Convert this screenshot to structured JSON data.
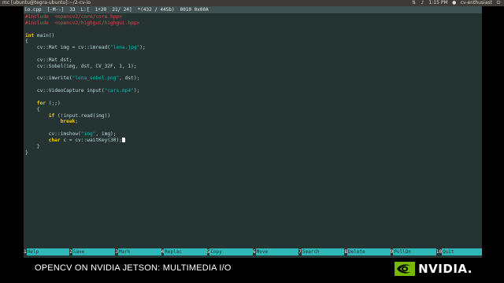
{
  "window": {
    "title": "mc [ubuntu@tegra-ubuntu]:~/2-cv-io",
    "tray_time": "1:15 PM",
    "tray_user": "cv-enthusiast"
  },
  "statusline": {
    "file": "io.cpp",
    "mode": "[-M--]",
    "col": "33",
    "lines": "L:[  1+20  21/ 24]",
    "char": "*(432 / 445b)",
    "code": "0010 0x00A"
  },
  "code": {
    "include1": "#include  <opencv2/core/core.hpp>",
    "include2": "#include  <opencv2/highgui/highgui.hpp>",
    "main_kw": "int",
    "main_sig": " main()",
    "open_brace": "{",
    "mat_img_pre": "    cv::Mat img = cv::imread(",
    "mat_img_str": "\"lena.jpg\"",
    "mat_img_post": ");",
    "mat_dst": "    cv::Mat dst;",
    "sobel": "    cv::Sobel(img, dst, CV_32F, 1, 1);",
    "imwrite_pre": "    cv::imwrite(",
    "imwrite_str": "\"lena_sobel.png\"",
    "imwrite_post": ", dst);",
    "vc_pre": "    cv::VideoCapture input(",
    "vc_str": "\"cars.mp4\"",
    "vc_post": ");",
    "for_kw": "    for",
    "for_rest": " (;;)",
    "inner_open": "    {",
    "if_kw": "        if",
    "if_rest": " (!input.read(img))",
    "break_kw": "            break",
    "break_semi": ";",
    "imshow_pre": "        cv::imshow(",
    "imshow_str": "\"img\"",
    "imshow_post": ", img);",
    "char_kw": "        char",
    "char_rest": " c = cv::waitKey(30);",
    "inner_close": "    }",
    "close_brace": "}"
  },
  "fkeys": [
    {
      "num": "1",
      "label": "Help"
    },
    {
      "num": "2",
      "label": "Save"
    },
    {
      "num": "3",
      "label": "Mark"
    },
    {
      "num": "4",
      "label": "Replac"
    },
    {
      "num": "5",
      "label": "Copy"
    },
    {
      "num": "6",
      "label": "Move"
    },
    {
      "num": "7",
      "label": "Search"
    },
    {
      "num": "8",
      "label": "Delete"
    },
    {
      "num": "9",
      "label": "PullDn"
    },
    {
      "num": "10",
      "label": "Quit"
    }
  ],
  "caption": {
    "text": "OPENCV ON NVIDIA JETSON:  MULTIMEDIA I/O",
    "logo_word": "NVIDIA."
  },
  "colors": {
    "terminal_bg": "#263333",
    "keyword": "#f0d000",
    "string": "#00bcbc",
    "preprocessor": "#e04848",
    "nvidia_green": "#76b900"
  }
}
